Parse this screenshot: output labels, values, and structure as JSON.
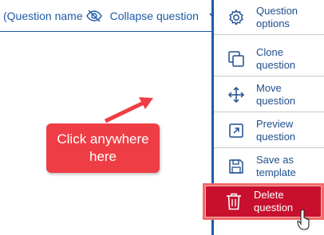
{
  "header": {
    "question_name": "(Question name",
    "collapse_label": "Collapse question",
    "eye_icon": "eye-off-icon",
    "chevron_icon": "chevron-down-icon"
  },
  "menu": {
    "items": [
      {
        "label": "Question options",
        "icon": "gear-icon"
      },
      {
        "label": "Clone question",
        "icon": "clone-icon"
      },
      {
        "label": "Move question",
        "icon": "move-icon"
      },
      {
        "label": "Preview question",
        "icon": "preview-icon"
      },
      {
        "label": "Save as template",
        "icon": "save-icon"
      },
      {
        "label": "Delete question",
        "icon": "trash-icon"
      }
    ]
  },
  "callout": {
    "text": "Click anywhere here"
  },
  "colors": {
    "accent": "#1f5aa6",
    "delete_bg": "#c8102e",
    "callout_bg": "#ee3d44"
  }
}
